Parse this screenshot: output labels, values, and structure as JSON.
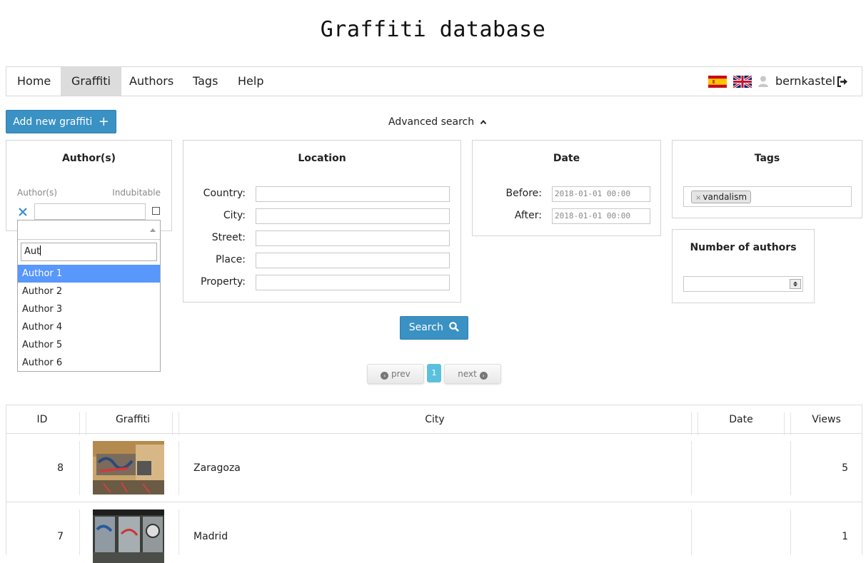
{
  "site_title": "Graffiti database",
  "nav": {
    "items": [
      {
        "label": "Home"
      },
      {
        "label": "Graffiti"
      },
      {
        "label": "Authors"
      },
      {
        "label": "Tags"
      },
      {
        "label": "Help"
      }
    ],
    "active_index": 1,
    "username": "bernkastel"
  },
  "toolbar": {
    "add_button_label": "Add new graffiti",
    "advanced_search_label": "Advanced search"
  },
  "authors_panel": {
    "title": "Author(s)",
    "col_author_label": "Author(s)",
    "col_indubitable_label": "Indubitable",
    "dropdown": {
      "search_value": "Aut",
      "options": [
        "Author 1",
        "Author 2",
        "Author 3",
        "Author 4",
        "Author 5",
        "Author 6"
      ],
      "highlighted_index": 0
    }
  },
  "location_panel": {
    "title": "Location",
    "fields": [
      {
        "label": "Country:"
      },
      {
        "label": "City:"
      },
      {
        "label": "Street:"
      },
      {
        "label": "Place:"
      },
      {
        "label": "Property:"
      }
    ]
  },
  "date_panel": {
    "title": "Date",
    "before_label": "Before:",
    "after_label": "After:",
    "before_placeholder": "2018-01-01 00:00",
    "after_placeholder": "2018-01-01 00:00"
  },
  "tags_panel": {
    "title": "Tags",
    "tags": [
      "vandalism"
    ]
  },
  "num_authors_panel": {
    "title": "Number of authors"
  },
  "search_button_label": "Search",
  "pagination": {
    "prev_label": "prev",
    "next_label": "next",
    "current_page": "1"
  },
  "table": {
    "columns": [
      "ID",
      "Graffiti",
      "City",
      "Date",
      "Views"
    ],
    "rows": [
      {
        "id": "8",
        "city": "Zaragoza",
        "date": "",
        "views": "5"
      },
      {
        "id": "7",
        "city": "Madrid",
        "date": "",
        "views": "1"
      }
    ]
  },
  "colors": {
    "primary": "#3a91c4",
    "nav_active_bg": "#dcdcdc",
    "dropdown_highlight": "#5897fb",
    "page_current": "#5bc0de"
  }
}
